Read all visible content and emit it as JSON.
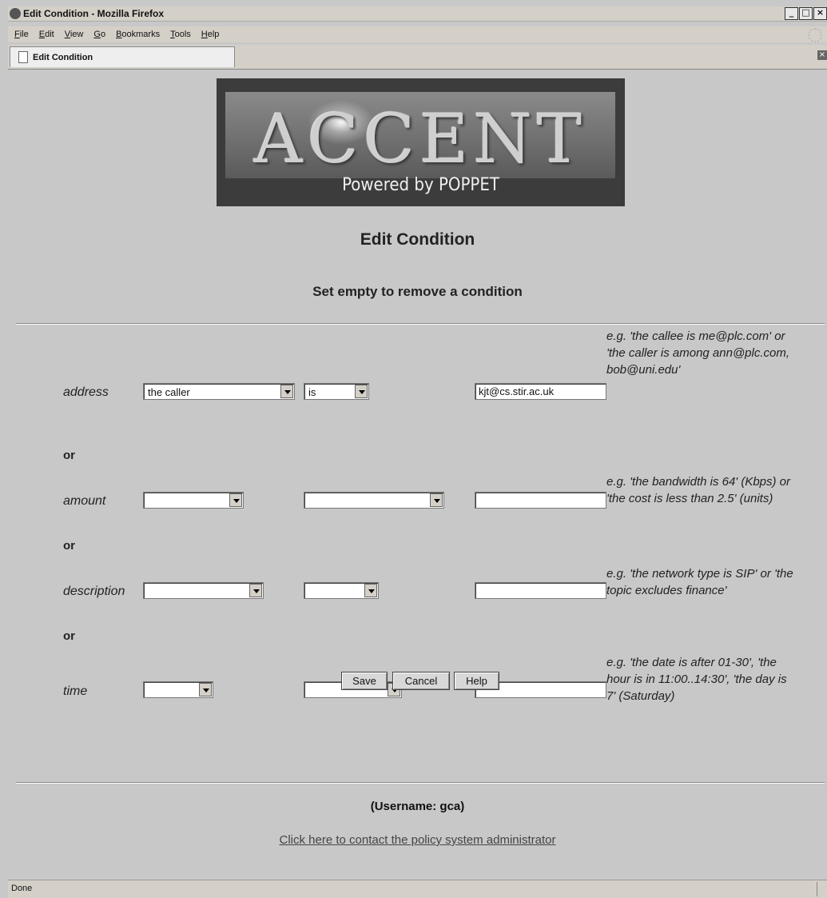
{
  "window": {
    "title": "Edit Condition - Mozilla Firefox"
  },
  "menu": [
    "File",
    "Edit",
    "View",
    "Go",
    "Bookmarks",
    "Tools",
    "Help"
  ],
  "tab": {
    "label": "Edit Condition"
  },
  "banner": {
    "title": "ACCENT",
    "subtitle": "Powered by POPPET"
  },
  "page": {
    "title": "Edit Condition",
    "subtitle": "Set empty to remove a condition"
  },
  "conditions": [
    {
      "label": "address",
      "param": "the caller",
      "operator": "is",
      "value": "kjt@cs.stir.ac.uk",
      "hint": "e.g. 'the callee is me@plc.com' or 'the caller is among ann@plc.com, bob@uni.edu'"
    },
    {
      "label": "amount",
      "param": "",
      "operator": "",
      "value": "",
      "hint": "e.g. 'the bandwidth is 64' (Kbps) or 'the cost is less than 2.5' (units)"
    },
    {
      "label": "description",
      "param": "",
      "operator": "",
      "value": "",
      "hint": "e.g. 'the network type is SIP' or 'the topic excludes finance'"
    },
    {
      "label": "time",
      "param": "",
      "operator": "",
      "value": "",
      "hint": "e.g. 'the date is after 01-30', 'the hour is in 11:00..14:30', 'the day is 7' (Saturday)"
    }
  ],
  "connector": "or",
  "buttons": {
    "save": "Save",
    "cancel": "Cancel",
    "help": "Help"
  },
  "footer": {
    "username": "(Username: gca)",
    "admin_link": "Click here to contact the policy system administrator"
  },
  "status": "Done"
}
